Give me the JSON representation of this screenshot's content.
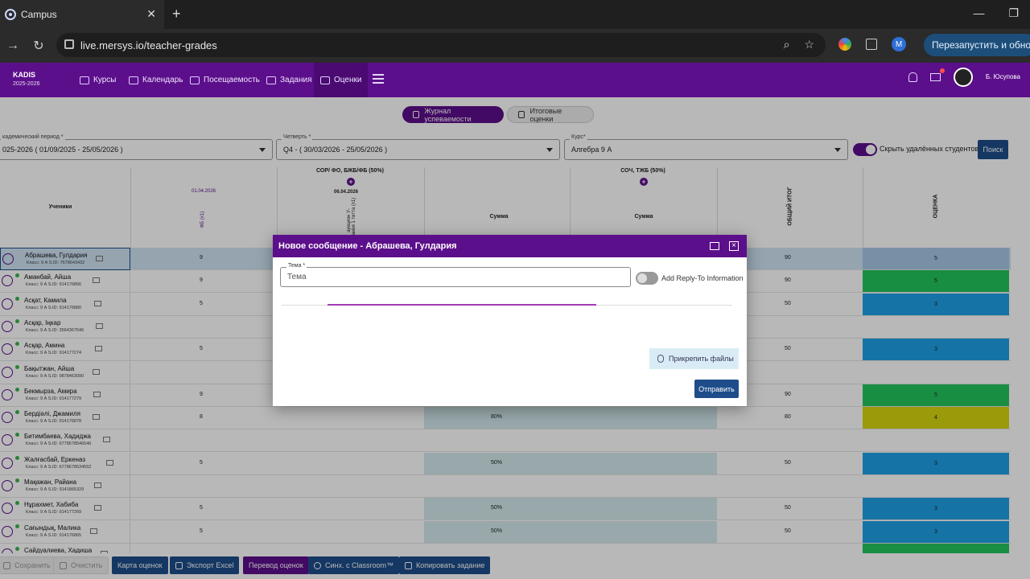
{
  "browser": {
    "tab_title": "Campus",
    "url": "live.mersys.io/teacher-grades",
    "profile_initial": "M",
    "relaunch_label": "Перезапустить и обновить"
  },
  "app": {
    "brand": "KADIS",
    "brand_year": "2025-2026",
    "nav": [
      "Курсы",
      "Календарь",
      "Посещаемость",
      "Задания",
      "Оценки"
    ],
    "user_name": "Б. Юсупова"
  },
  "tabs": {
    "journal": "Журнал успеваемости",
    "final": "Итоговые оценки"
  },
  "filters": {
    "period_label": "кадемический период *",
    "period_value": "025-2026 ( 01/09/2025 - 25/05/2026 )",
    "quarter_label": "Четверть *",
    "quarter_value": "Q4 - ( 30/03/2026 - 25/05/2026 )",
    "course_label": "Курс*",
    "course_value": "Алгебра 9 А",
    "hide_deleted_label": "Скрыть удалённых студентов",
    "search_label": "Поиск"
  },
  "grid": {
    "students_header": "Ученики",
    "group1": "СОР/ ФО, БЖБ/ФБ (50%)",
    "group2": "СОЧ, ТЖБ (50%)",
    "date1": "01.04.2026",
    "date2": "06.04.2026",
    "col_fo": "ФБ (x1)",
    "col_bzhb": "аукцион У-\nрования 1 титта (x1)",
    "sum1": "Сумма",
    "sum2": "Сумма",
    "total": "ОБЩИЙ ИТОГ",
    "grade": "ОЦЕНКА",
    "rows": [
      {
        "name": "Абрашева, Гулдария",
        "meta": "Класс: 9 А   S.ID: 7678643432",
        "fo": "9",
        "sum": "",
        "total": "90",
        "grade": "5",
        "color": "#a7c8e6"
      },
      {
        "name": "Аманбай, Айша",
        "meta": "Класс: 9 А   S.ID: 914176856",
        "fo": "9",
        "sum": "",
        "total": "90",
        "grade": "5",
        "color": "#22c55e"
      },
      {
        "name": "Асқат, Камила",
        "meta": "Класс: 9 А   S.ID: 914176880",
        "fo": "5",
        "sum": "",
        "total": "50",
        "grade": "3",
        "color": "#1ea0e6"
      },
      {
        "name": "Асқар, Іңкар",
        "meta": "Класс: 9 А   S.ID: 3564367546",
        "fo": "",
        "sum": "",
        "total": "",
        "grade": "",
        "color": ""
      },
      {
        "name": "Асқар, Амина",
        "meta": "Класс: 9 А   S.ID: 914177274",
        "fo": "5",
        "sum": "",
        "total": "50",
        "grade": "3",
        "color": "#1ea0e6"
      },
      {
        "name": "Бақытжан, Айша",
        "meta": "Класс: 9 А   S.ID: 9878463090",
        "fo": "",
        "sum": "",
        "total": "",
        "grade": "",
        "color": ""
      },
      {
        "name": "Бекмырза, Амира",
        "meta": "Класс: 9 А   S.ID: 914177279",
        "fo": "9",
        "sum": "",
        "total": "90",
        "grade": "5",
        "color": "#22c55e"
      },
      {
        "name": "Бердіәлі, Джамиля",
        "meta": "Класс: 9 А   S.ID: 914176878",
        "fo": "8",
        "sum": "80%",
        "total": "80",
        "grade": "4",
        "color": "#d6d60f"
      },
      {
        "name": "Битимбаева, Хадиджа",
        "meta": "Класс: 9 А   S.ID: 6778678546546",
        "fo": "",
        "sum": "",
        "total": "",
        "grade": "",
        "color": ""
      },
      {
        "name": "Жалғасбай, Еркеназ",
        "meta": "Класс: 9 А   S.ID: 6778678534552",
        "fo": "5",
        "sum": "50%",
        "total": "50",
        "grade": "3",
        "color": "#1ea0e6"
      },
      {
        "name": "Мақажан, Райана",
        "meta": "Класс: 9 А   S.ID: 9141865329",
        "fo": "",
        "sum": "",
        "total": "",
        "grade": "",
        "color": ""
      },
      {
        "name": "Нұрахмет, Хабиба",
        "meta": "Класс: 9 А   S.ID: 914177269",
        "fo": "5",
        "sum": "50%",
        "total": "50",
        "grade": "3",
        "color": "#1ea0e6"
      },
      {
        "name": "Сағындық, Малика",
        "meta": "Класс: 9 А   S.ID: 914176865",
        "fo": "5",
        "sum": "50%",
        "total": "50",
        "grade": "3",
        "color": "#1ea0e6"
      },
      {
        "name": "Сайдуалиева, Хадиша",
        "meta": "",
        "fo": "",
        "sum": "",
        "total": "",
        "grade": "",
        "color": "#22c55e"
      }
    ]
  },
  "modal": {
    "title": "Новое сообщение - Абрашева, Гулдария",
    "subject_label": "Тема *",
    "subject_placeholder": "Тема",
    "reply_to_label": "Add Reply-To Information",
    "progress": 0.6,
    "attach_label": "Прикрепить файлы",
    "send_label": "Отправить"
  },
  "bottom": {
    "save": "Сохранить",
    "clear": "Очистить",
    "grade_map": "Карта оценок",
    "export_excel": "Экспорт Excel",
    "translate_grades": "Перевод оценок",
    "sync_classroom": "Синх. с Classroom™",
    "copy_task": "Копировать задание"
  },
  "colors": {
    "brand": "#5c0f8b",
    "primary_button": "#1e4d8a"
  }
}
